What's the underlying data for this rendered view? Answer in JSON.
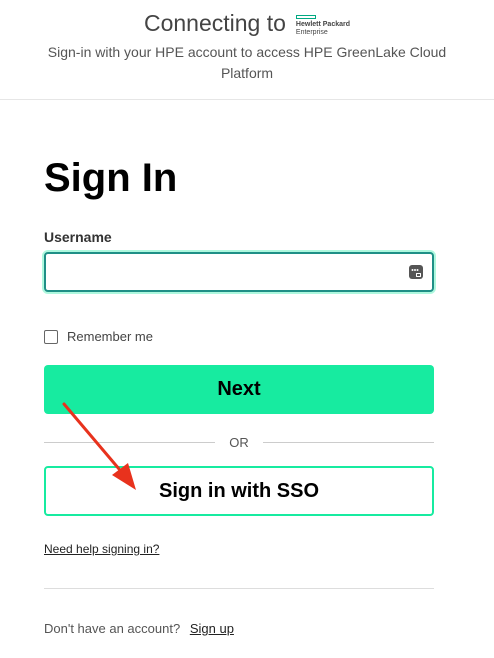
{
  "header": {
    "connecting_text": "Connecting to",
    "logo_line1": "Hewlett Packard",
    "logo_line2": "Enterprise",
    "subtitle": "Sign-in with your HPE account to access HPE GreenLake Cloud Platform"
  },
  "form": {
    "title": "Sign In",
    "username_label": "Username",
    "username_value": "",
    "remember_label": "Remember me",
    "remember_checked": false,
    "next_label": "Next",
    "or_label": "OR",
    "sso_label": "Sign in with SSO",
    "help_link": "Need help signing in?"
  },
  "footer": {
    "no_account_text": "Don't have an account?",
    "signup_link": "Sign up"
  },
  "icons": {
    "password_manager": "password-manager-icon",
    "annotation": "red-arrow-annotation"
  },
  "colors": {
    "brand_green": "#17eba0",
    "focus_border": "#1f8f86",
    "logo_green": "#01a982",
    "annotation_red": "#e8321d"
  }
}
